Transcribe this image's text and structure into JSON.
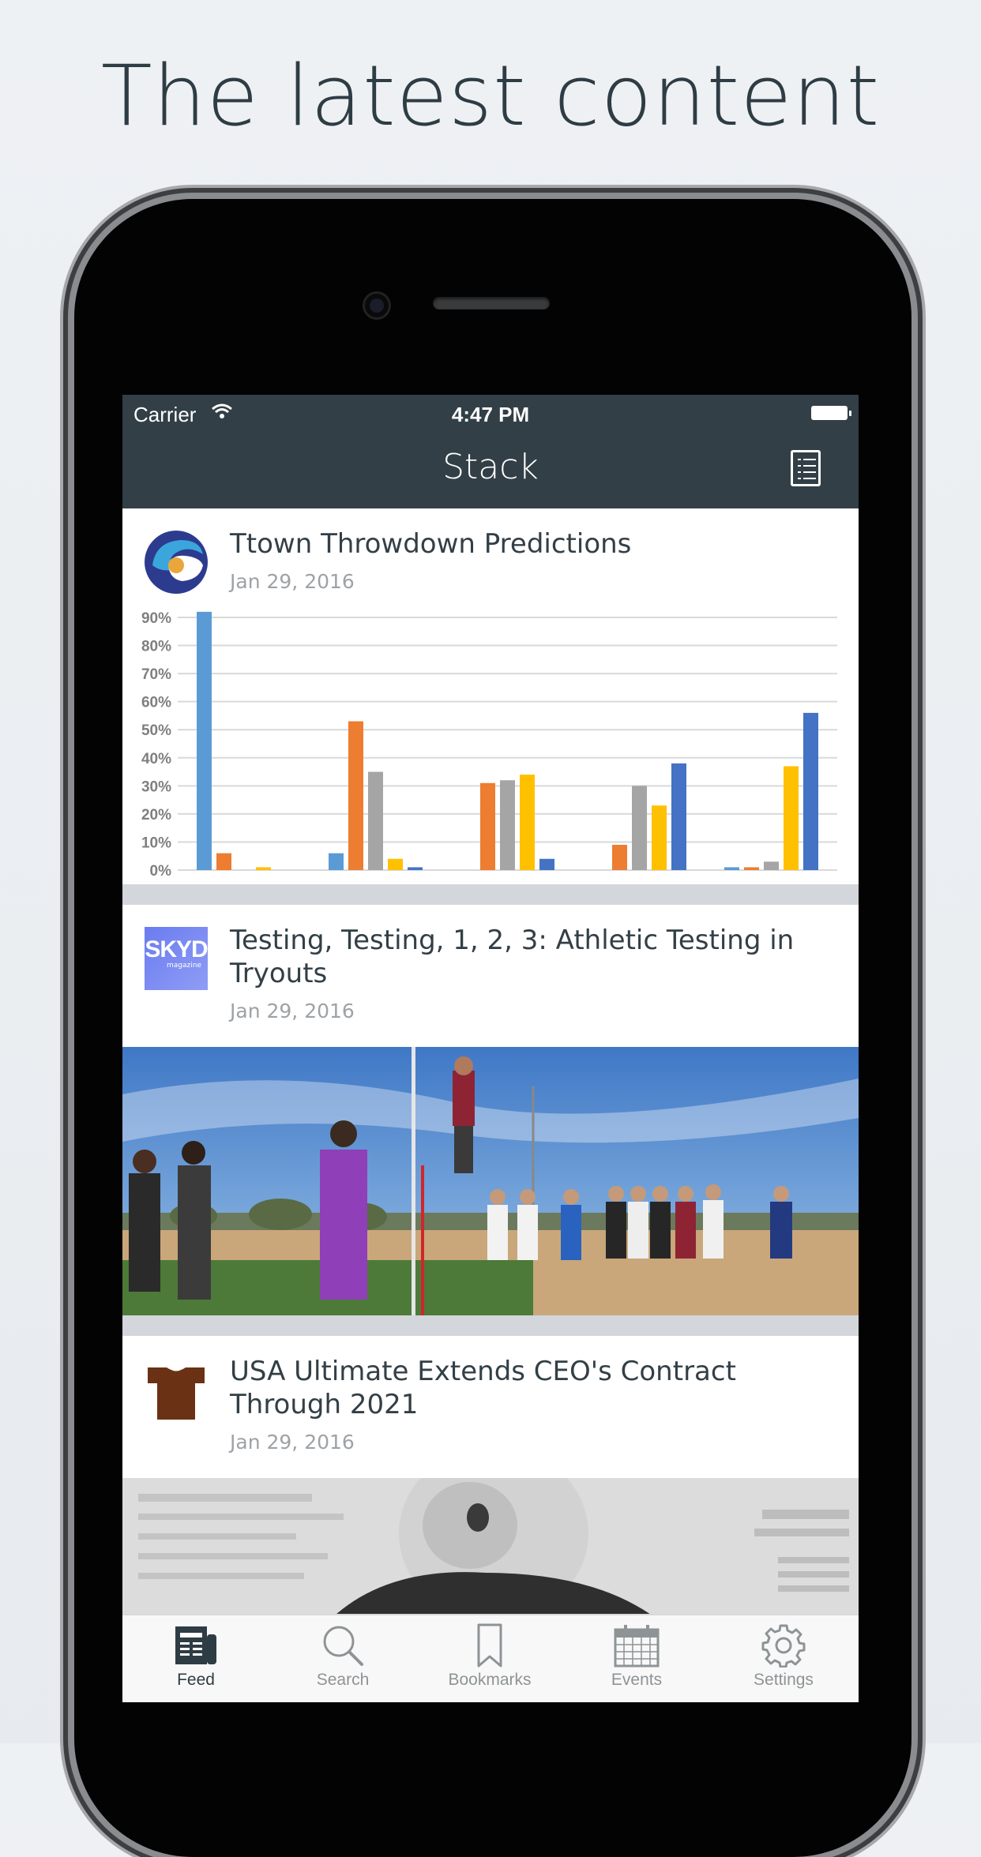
{
  "headline": "The latest content",
  "status_bar": {
    "carrier": "Carrier",
    "time": "4:47 PM"
  },
  "nav": {
    "title": "Stack"
  },
  "feed": [
    {
      "title": "Ttown Throwdown Predictions",
      "date": "Jan 29, 2016",
      "source_icon": "wave-logo-icon"
    },
    {
      "title": "Testing, Testing, 1, 2, 3: Athletic Testing in Tryouts",
      "date": "Jan 29, 2016",
      "source_icon": "skyd-logo",
      "source_logo_text": "SKYD",
      "source_logo_subtext": "magazine"
    },
    {
      "title": "USA Ultimate Extends CEO's Contract Through 2021",
      "date": "Jan 29, 2016",
      "source_icon": "jersey-icon"
    }
  ],
  "chart_data": {
    "type": "bar",
    "categories": [
      "",
      "",
      "",
      "",
      ""
    ],
    "series": [
      {
        "color": "#5b9bd5",
        "values": [
          92,
          6,
          0,
          0,
          1
        ]
      },
      {
        "color": "#ed7d31",
        "values": [
          6,
          53,
          31,
          9,
          1
        ]
      },
      {
        "color": "#a5a5a5",
        "values": [
          0,
          35,
          32,
          30,
          3
        ]
      },
      {
        "color": "#ffc000",
        "values": [
          1,
          4,
          34,
          23,
          37
        ]
      },
      {
        "color": "#4472c4",
        "values": [
          0,
          1,
          4,
          38,
          56
        ]
      }
    ],
    "yticks": [
      "0%",
      "10%",
      "20%",
      "30%",
      "40%",
      "50%",
      "60%",
      "70%",
      "80%",
      "90%"
    ],
    "ylim": [
      0,
      90
    ],
    "grid": true
  },
  "tabbar": {
    "tabs": [
      {
        "label": "Feed",
        "icon": "newspaper-icon",
        "active": true
      },
      {
        "label": "Search",
        "icon": "search-icon",
        "active": false
      },
      {
        "label": "Bookmarks",
        "icon": "bookmark-icon",
        "active": false
      },
      {
        "label": "Events",
        "icon": "calendar-icon",
        "active": false
      },
      {
        "label": "Settings",
        "icon": "gear-icon",
        "active": false
      }
    ]
  },
  "colors": {
    "navbar": "#323f46",
    "separator": "#d3d6db",
    "text": "#333f46",
    "muted": "#9ea2a6"
  }
}
